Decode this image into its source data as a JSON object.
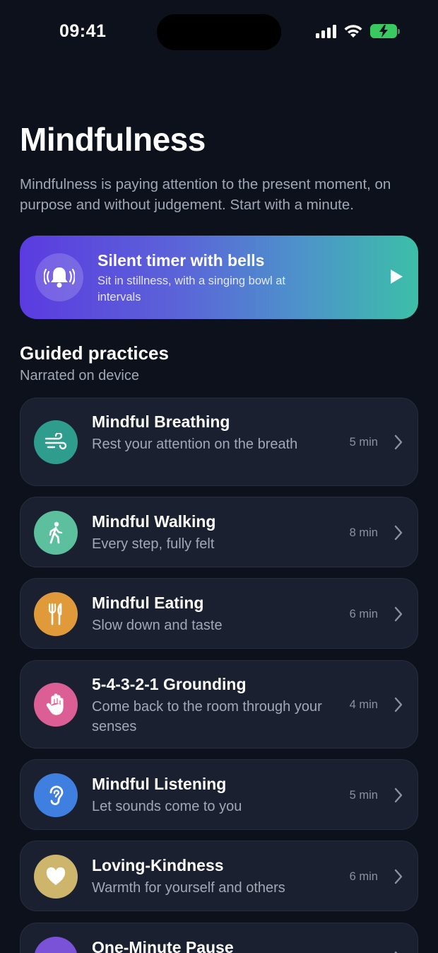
{
  "status": {
    "time": "09:41"
  },
  "page": {
    "title": "Mindfulness",
    "intro": "Mindfulness is paying attention to the present moment, on purpose and without judgement. Start with a minute."
  },
  "timer": {
    "title": "Silent timer with bells",
    "subtitle": "Sit in stillness, with a singing bowl at intervals",
    "icon": "bell-icon"
  },
  "guided": {
    "title": "Guided practices",
    "subtitle": "Narrated on device",
    "items": [
      {
        "title": "Mindful Breathing",
        "subtitle": "Rest your attention on the breath",
        "duration": "5 min",
        "icon": "wind-icon",
        "color": "#2f9d8e"
      },
      {
        "title": "Mindful Walking",
        "subtitle": "Every step, fully felt",
        "duration": "8 min",
        "icon": "walking-icon",
        "color": "#5cc09e"
      },
      {
        "title": "Mindful Eating",
        "subtitle": "Slow down and taste",
        "duration": "6 min",
        "icon": "fork-knife-icon",
        "color": "#e09a3a"
      },
      {
        "title": "5-4-3-2-1 Grounding",
        "subtitle": "Come back to the room through your senses",
        "duration": "4 min",
        "icon": "hand-icon",
        "color": "#db5e95"
      },
      {
        "title": "Mindful Listening",
        "subtitle": "Let sounds come to you",
        "duration": "5 min",
        "icon": "ear-icon",
        "color": "#3f7fe0"
      },
      {
        "title": "Loving-Kindness",
        "subtitle": "Warmth for yourself and others",
        "duration": "6 min",
        "icon": "heart-icon",
        "color": "#cdb56c"
      },
      {
        "title": "One-Minute Pause",
        "subtitle": "",
        "duration": "",
        "icon": "pause-icon",
        "color": "#7a52d8"
      }
    ]
  }
}
